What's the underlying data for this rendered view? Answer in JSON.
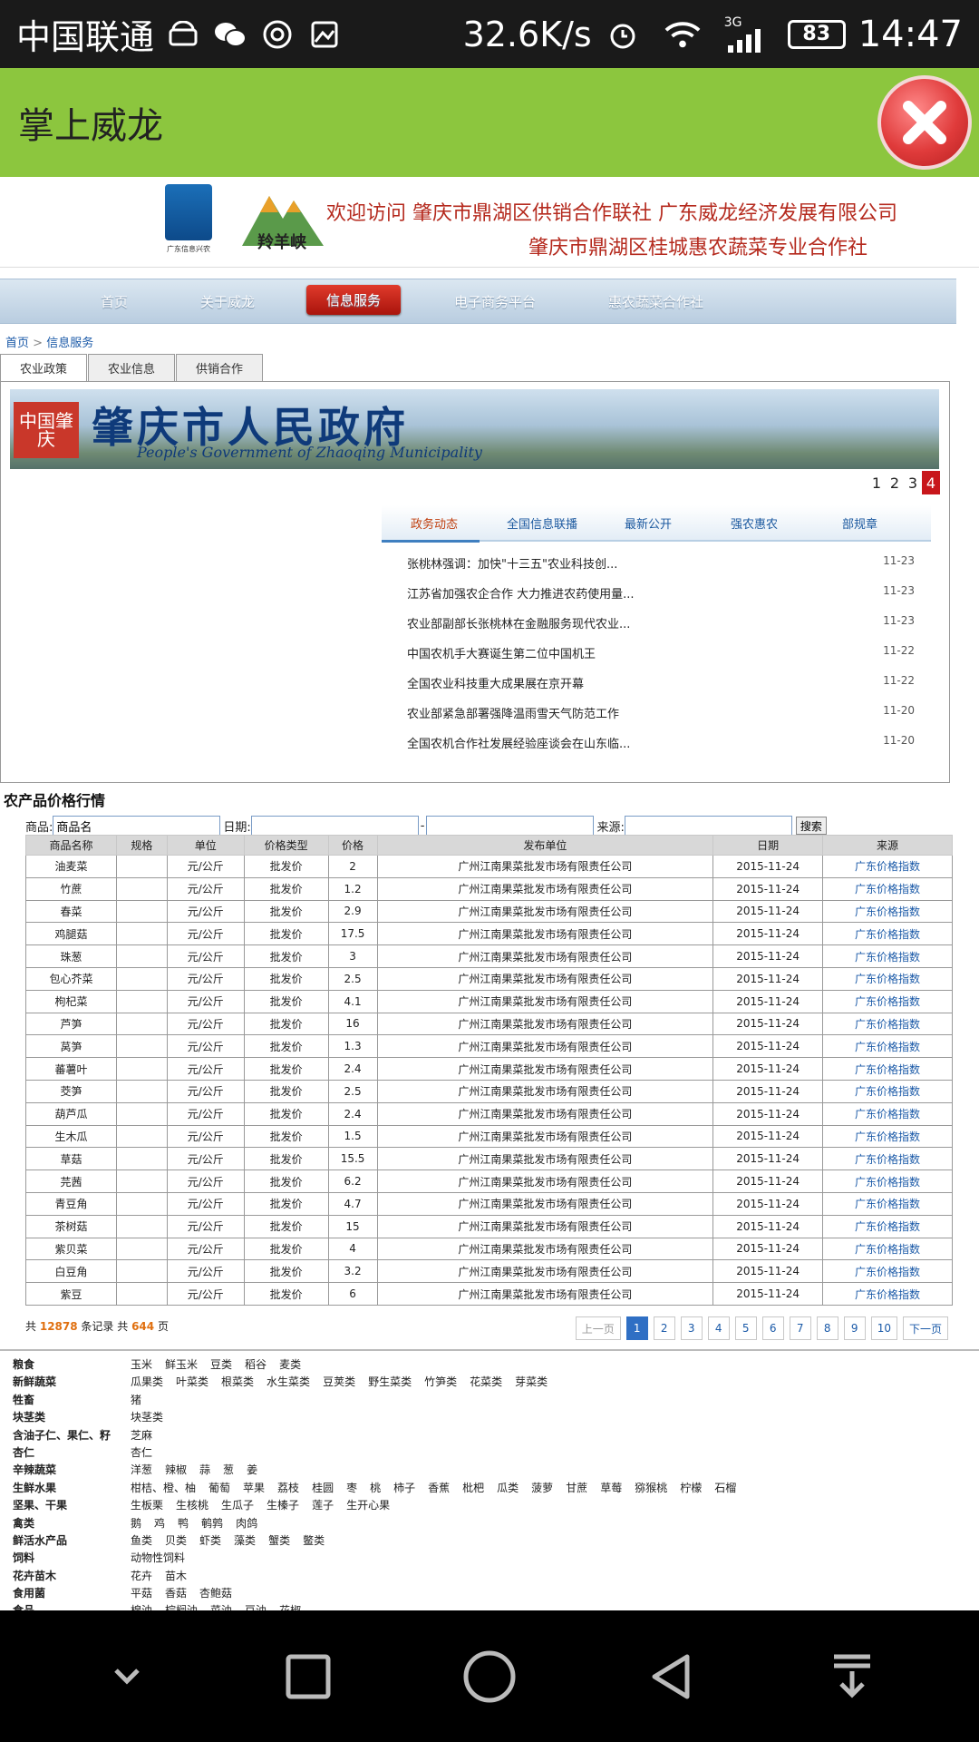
{
  "status_bar": {
    "carrier": "中国联通",
    "net_speed": "32.6K/s",
    "network": "3G",
    "battery": "83",
    "time": "14:47",
    "icons": [
      "android-icon",
      "wechat-icon",
      "app-icon",
      "image-icon",
      "alarm-icon",
      "wifi-icon",
      "signal-icon",
      "battery-icon"
    ]
  },
  "app": {
    "title": "掌上威龙",
    "close_icon": "close-icon"
  },
  "site": {
    "logo_caption": "广东信息兴农",
    "logo2_text": "羚羊峡",
    "banner_line1": "欢迎访问  肇庆市鼎湖区供销合作联社  广东威龙经济发展有限公司",
    "banner_line2": "肇庆市鼎湖区桂城惠农蔬菜专业合作社",
    "nav": [
      "首页",
      "关于威龙",
      "信息服务",
      "电子商务平台",
      "惠农蔬菜合作社"
    ],
    "breadcrumb": [
      "首页",
      "信息服务"
    ],
    "tabs": [
      "农业政策",
      "农业信息",
      "供销合作"
    ]
  },
  "gov_banner": {
    "seal": "中国肇庆",
    "title": "肇庆市人民政府",
    "subtitle": "People's Government of Zhaoqing Municipality",
    "pages": [
      "1",
      "2",
      "3",
      "4"
    ],
    "current_page": "4"
  },
  "news": {
    "tabs": [
      "政务动态",
      "全国信息联播",
      "最新公开",
      "强农惠农",
      "部规章"
    ],
    "items": [
      {
        "title": "张桃林强调：加快\"十三五\"农业科技创...",
        "date": "11-23"
      },
      {
        "title": "江苏省加强农企合作 大力推进农药使用量...",
        "date": "11-23"
      },
      {
        "title": "农业部副部长张桃林在金融服务现代农业...",
        "date": "11-23"
      },
      {
        "title": "中国农机手大赛诞生第二位中国机王",
        "date": "11-22"
      },
      {
        "title": "全国农业科技重大成果展在京开幕",
        "date": "11-22"
      },
      {
        "title": "农业部紧急部署强降温雨雪天气防范工作",
        "date": "11-20"
      },
      {
        "title": "全国农机合作社发展经验座谈会在山东临...",
        "date": "11-20"
      }
    ]
  },
  "prices": {
    "section_title": "农产品价格行情",
    "search": {
      "product_label": "商品:",
      "product_value": "商品名",
      "date_label": "日期:",
      "date_sep": "-",
      "source_label": "来源:",
      "button": "搜索"
    },
    "columns": [
      "商品名称",
      "规格",
      "单位",
      "价格类型",
      "价格",
      "发布单位",
      "日期",
      "来源"
    ],
    "rows": [
      [
        "油麦菜",
        "",
        "元/公斤",
        "批发价",
        "2",
        "广州江南果菜批发市场有限责任公司",
        "2015-11-24",
        "广东价格指数"
      ],
      [
        "竹蔗",
        "",
        "元/公斤",
        "批发价",
        "1.2",
        "广州江南果菜批发市场有限责任公司",
        "2015-11-24",
        "广东价格指数"
      ],
      [
        "春菜",
        "",
        "元/公斤",
        "批发价",
        "2.9",
        "广州江南果菜批发市场有限责任公司",
        "2015-11-24",
        "广东价格指数"
      ],
      [
        "鸡腿菇",
        "",
        "元/公斤",
        "批发价",
        "17.5",
        "广州江南果菜批发市场有限责任公司",
        "2015-11-24",
        "广东价格指数"
      ],
      [
        "珠葱",
        "",
        "元/公斤",
        "批发价",
        "3",
        "广州江南果菜批发市场有限责任公司",
        "2015-11-24",
        "广东价格指数"
      ],
      [
        "包心芥菜",
        "",
        "元/公斤",
        "批发价",
        "2.5",
        "广州江南果菜批发市场有限责任公司",
        "2015-11-24",
        "广东价格指数"
      ],
      [
        "枸杞菜",
        "",
        "元/公斤",
        "批发价",
        "4.1",
        "广州江南果菜批发市场有限责任公司",
        "2015-11-24",
        "广东价格指数"
      ],
      [
        "芦笋",
        "",
        "元/公斤",
        "批发价",
        "16",
        "广州江南果菜批发市场有限责任公司",
        "2015-11-24",
        "广东价格指数"
      ],
      [
        "莴笋",
        "",
        "元/公斤",
        "批发价",
        "1.3",
        "广州江南果菜批发市场有限责任公司",
        "2015-11-24",
        "广东价格指数"
      ],
      [
        "蕃薯叶",
        "",
        "元/公斤",
        "批发价",
        "2.4",
        "广州江南果菜批发市场有限责任公司",
        "2015-11-24",
        "广东价格指数"
      ],
      [
        "茭笋",
        "",
        "元/公斤",
        "批发价",
        "2.5",
        "广州江南果菜批发市场有限责任公司",
        "2015-11-24",
        "广东价格指数"
      ],
      [
        "葫芦瓜",
        "",
        "元/公斤",
        "批发价",
        "2.4",
        "广州江南果菜批发市场有限责任公司",
        "2015-11-24",
        "广东价格指数"
      ],
      [
        "生木瓜",
        "",
        "元/公斤",
        "批发价",
        "1.5",
        "广州江南果菜批发市场有限责任公司",
        "2015-11-24",
        "广东价格指数"
      ],
      [
        "草菇",
        "",
        "元/公斤",
        "批发价",
        "15.5",
        "广州江南果菜批发市场有限责任公司",
        "2015-11-24",
        "广东价格指数"
      ],
      [
        "芫茜",
        "",
        "元/公斤",
        "批发价",
        "6.2",
        "广州江南果菜批发市场有限责任公司",
        "2015-11-24",
        "广东价格指数"
      ],
      [
        "青豆角",
        "",
        "元/公斤",
        "批发价",
        "4.7",
        "广州江南果菜批发市场有限责任公司",
        "2015-11-24",
        "广东价格指数"
      ],
      [
        "茶树菇",
        "",
        "元/公斤",
        "批发价",
        "15",
        "广州江南果菜批发市场有限责任公司",
        "2015-11-24",
        "广东价格指数"
      ],
      [
        "紫贝菜",
        "",
        "元/公斤",
        "批发价",
        "4",
        "广州江南果菜批发市场有限责任公司",
        "2015-11-24",
        "广东价格指数"
      ],
      [
        "白豆角",
        "",
        "元/公斤",
        "批发价",
        "3.2",
        "广州江南果菜批发市场有限责任公司",
        "2015-11-24",
        "广东价格指数"
      ],
      [
        "紫豆",
        "",
        "元/公斤",
        "批发价",
        "6",
        "广州江南果菜批发市场有限责任公司",
        "2015-11-24",
        "广东价格指数"
      ]
    ],
    "summary": {
      "prefix": "共",
      "records": "12878",
      "mid": "条记录 共",
      "pages": "644",
      "suffix": "页"
    },
    "pager": {
      "prev": "上一页",
      "pages": [
        "1",
        "2",
        "3",
        "4",
        "5",
        "6",
        "7",
        "8",
        "9",
        "10"
      ],
      "current": "1",
      "next": "下一页"
    }
  },
  "categories": [
    {
      "name": "粮食",
      "items": [
        "玉米",
        "鲜玉米",
        "豆类",
        "稻谷",
        "麦类"
      ]
    },
    {
      "name": "新鲜蔬菜",
      "items": [
        "瓜果类",
        "叶菜类",
        "根菜类",
        "水生菜类",
        "豆荚类",
        "野生菜类",
        "竹笋类",
        "花菜类",
        "芽菜类"
      ]
    },
    {
      "name": "牲畜",
      "items": [
        "猪"
      ]
    },
    {
      "name": "块茎类",
      "items": [
        "块茎类"
      ]
    },
    {
      "name": "含油子仁、果仁、籽",
      "items": [
        "芝麻"
      ]
    },
    {
      "name": "杏仁",
      "items": [
        "杏仁"
      ]
    },
    {
      "name": "辛辣蔬菜",
      "items": [
        "洋葱",
        "辣椒",
        "蒜",
        "葱",
        "姜"
      ]
    },
    {
      "name": "生鲜水果",
      "items": [
        "柑桔、橙、柚",
        "葡萄",
        "苹果",
        "荔枝",
        "桂圆",
        "枣",
        "桃",
        "柿子",
        "香蕉",
        "枇杷",
        "瓜类",
        "菠萝",
        "甘蔗",
        "草莓",
        "猕猴桃",
        "柠檬",
        "石榴"
      ]
    },
    {
      "name": "坚果、干果",
      "items": [
        "生板栗",
        "生核桃",
        "生瓜子",
        "生榛子",
        "莲子",
        "生开心果"
      ]
    },
    {
      "name": "禽类",
      "items": [
        "鹅",
        "鸡",
        "鸭",
        "鹌鹑",
        "肉鸽"
      ]
    },
    {
      "name": "鲜活水产品",
      "items": [
        "鱼类",
        "贝类",
        "虾类",
        "藻类",
        "蟹类",
        "鳖类"
      ]
    },
    {
      "name": "饲料",
      "items": [
        "动物性饲料"
      ]
    },
    {
      "name": "花卉苗木",
      "items": [
        "花卉",
        "苗木"
      ]
    },
    {
      "name": "食用菌",
      "items": [
        "平菇",
        "香菇",
        "杏鲍菇"
      ]
    },
    {
      "name": "食品",
      "items": [
        "棉油",
        "棕榈油",
        "菜油",
        "豆油",
        "花椒"
      ]
    }
  ],
  "navbar": [
    "collapse-icon",
    "recent-apps-icon",
    "home-icon",
    "back-icon",
    "notification-pulldown-icon"
  ]
}
